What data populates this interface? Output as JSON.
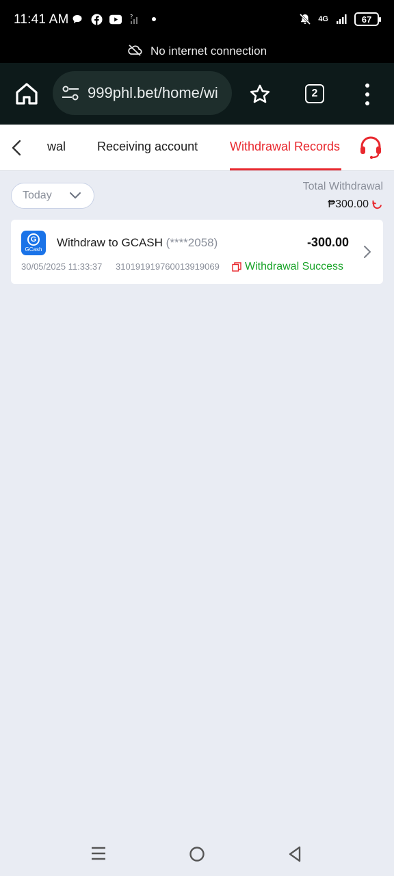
{
  "status_bar": {
    "time": "11:41 AM",
    "network": "4G",
    "battery": "67"
  },
  "offline_banner": {
    "text": "No internet connection"
  },
  "browser": {
    "url": "999phl.bet/home/wi",
    "tab_count": "2"
  },
  "tabs": {
    "items": [
      {
        "label": "wal"
      },
      {
        "label": "Receiving account"
      },
      {
        "label": "Withdrawal Records",
        "active": true
      }
    ]
  },
  "filter": {
    "selected": "Today"
  },
  "summary": {
    "label": "Total Withdrawal",
    "amount": "₱300.00"
  },
  "records": [
    {
      "logo_label": "GCash",
      "logo_letter": "G",
      "title": "Withdraw to GCASH",
      "masked_account": "(****2058)",
      "amount": "-300.00",
      "datetime": "30/05/2025 11:33:37",
      "transaction_id": "310191919760013919069",
      "status": "Withdrawal Success"
    }
  ],
  "colors": {
    "accent": "#e8282e",
    "success": "#18a328",
    "gcash_blue": "#1a73e8",
    "background": "#e9ecf3"
  }
}
